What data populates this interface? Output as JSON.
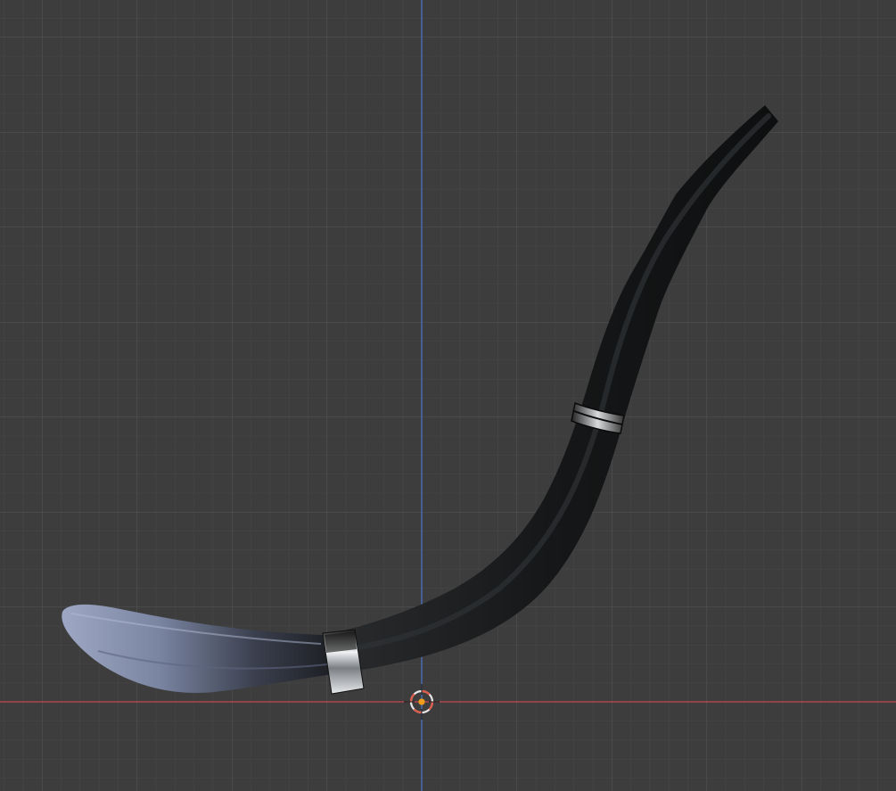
{
  "viewport": {
    "background_color": "#3d3d3d",
    "grid_minor_color": "#484848",
    "grid_major_color": "#555555",
    "x_axis_color": "#c24a52",
    "y_axis_color": "#4a72c2",
    "cursor_ring_color": "#e8e8e8",
    "cursor_accent_color": "#e05a4a",
    "origin_color": "#f29c1b"
  },
  "object": {
    "body_color": "#151718",
    "tip_color": "#8e99b5",
    "band_color": "#c9ccd0"
  },
  "icons": {
    "cursor": "3d-cursor-icon",
    "origin": "object-origin-icon"
  }
}
